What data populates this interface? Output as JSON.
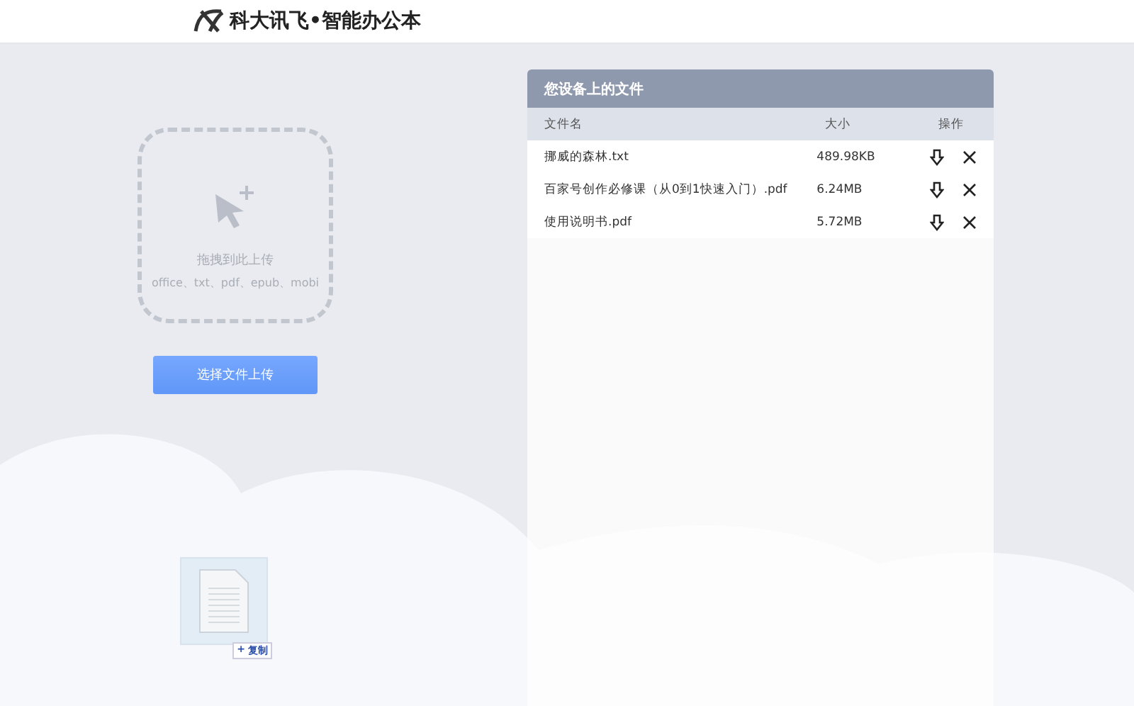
{
  "header": {
    "brand": "科大讯飞•智能办公本"
  },
  "upload": {
    "title": "拖拽到此上传",
    "formats": "office、txt、pdf、epub、mobi",
    "button": "选择文件上传"
  },
  "drag_ghost": {
    "badge_icon": "+",
    "badge": "复制"
  },
  "files_panel": {
    "title": "您设备上的文件",
    "columns": [
      "文件名",
      "大小",
      "操作"
    ],
    "rows": [
      {
        "name": "挪威的森林.txt",
        "size": "489.98KB"
      },
      {
        "name": "百家号创作必修课（从0到1快速入门）.pdf",
        "size": "6.24MB"
      },
      {
        "name": "使用说明书.pdf",
        "size": "5.72MB"
      }
    ]
  }
}
